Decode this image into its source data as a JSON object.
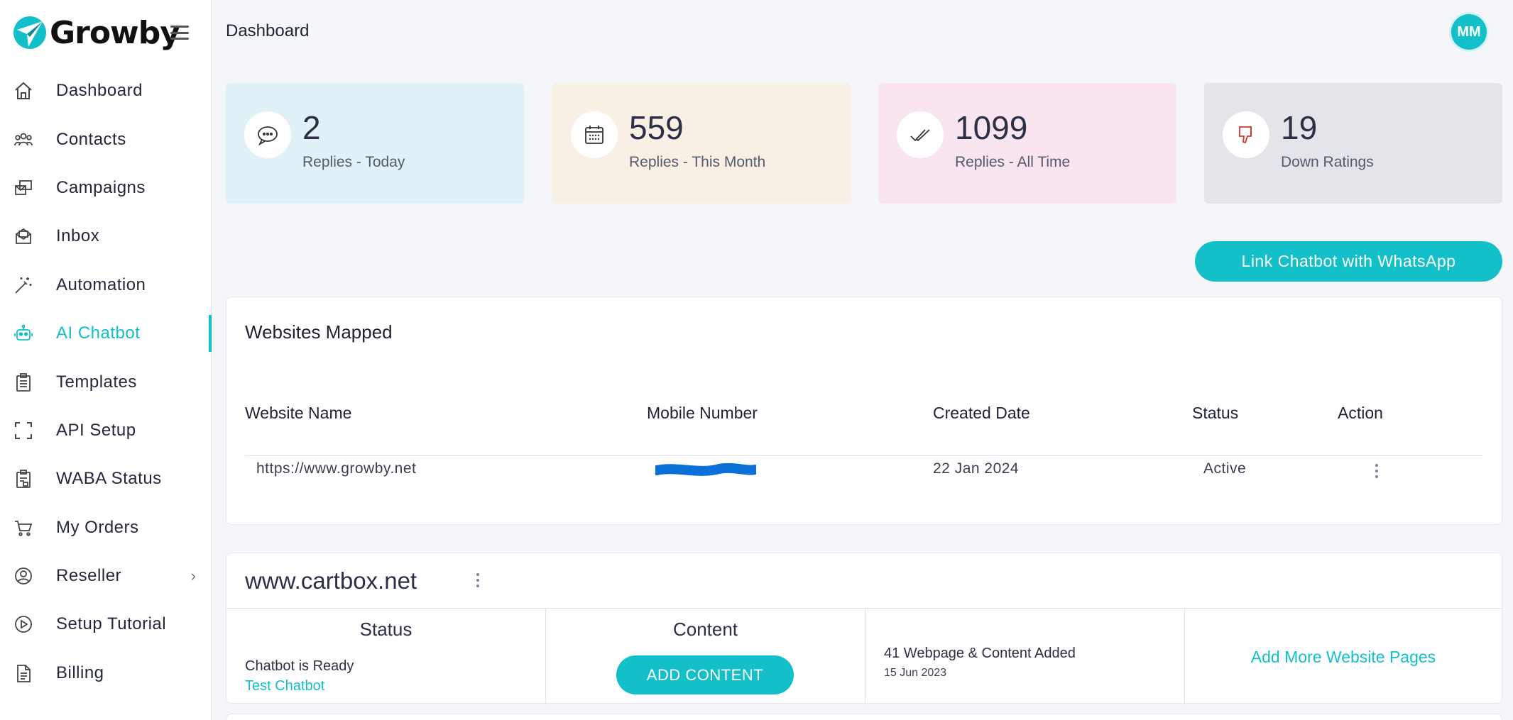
{
  "brand": {
    "name": "Growby",
    "accent": "#13bfc9"
  },
  "header": {
    "title": "Dashboard",
    "avatar_initials": "MM"
  },
  "sidebar": {
    "items": [
      {
        "label": "Dashboard",
        "icon": "home-icon"
      },
      {
        "label": "Contacts",
        "icon": "users-icon"
      },
      {
        "label": "Campaigns",
        "icon": "campaigns-icon"
      },
      {
        "label": "Inbox",
        "icon": "inbox-icon"
      },
      {
        "label": "Automation",
        "icon": "wand-icon"
      },
      {
        "label": "AI Chatbot",
        "icon": "robot-icon",
        "active": true
      },
      {
        "label": "Templates",
        "icon": "clipboard-icon"
      },
      {
        "label": "API Setup",
        "icon": "frame-icon"
      },
      {
        "label": "WABA Status",
        "icon": "clipboard-check-icon"
      },
      {
        "label": "My Orders",
        "icon": "cart-icon"
      },
      {
        "label": "Reseller",
        "icon": "user-circle-icon",
        "chevron": "›"
      },
      {
        "label": "Setup Tutorial",
        "icon": "play-circle-icon"
      },
      {
        "label": "Billing",
        "icon": "document-icon"
      }
    ]
  },
  "stats": [
    {
      "value": "2",
      "label": "Replies - Today",
      "bg": "#e1f1f8",
      "icon": "chat-bubble-icon"
    },
    {
      "value": "559",
      "label": "Replies - This Month",
      "bg": "#f8f0e5",
      "icon": "calendar-icon"
    },
    {
      "value": "1099",
      "label": "Replies - All Time",
      "bg": "#f8e5ef",
      "icon": "double-check-icon"
    },
    {
      "value": "19",
      "label": "Down Ratings",
      "bg": "#e4e5ea",
      "icon": "thumbs-down-icon"
    }
  ],
  "link_button": "Link Chatbot with WhatsApp",
  "websites_mapped": {
    "title": "Websites Mapped",
    "columns": [
      "Website Name",
      "Mobile Number",
      "Created Date",
      "Status",
      "Action"
    ],
    "rows": [
      {
        "website": "https://www.growby.net",
        "mobile": "",
        "created": "22 Jan 2024",
        "status": "Active"
      }
    ]
  },
  "site_card": {
    "title": "www.cartbox.net",
    "status_heading": "Status",
    "status_text": "Chatbot is Ready",
    "test_link": "Test Chatbot",
    "content_heading": "Content",
    "add_content": "ADD CONTENT",
    "pages_added": "41 Webpage & Content Added",
    "pages_date": "15 Jun 2023",
    "more_link": "Add More Website Pages"
  }
}
